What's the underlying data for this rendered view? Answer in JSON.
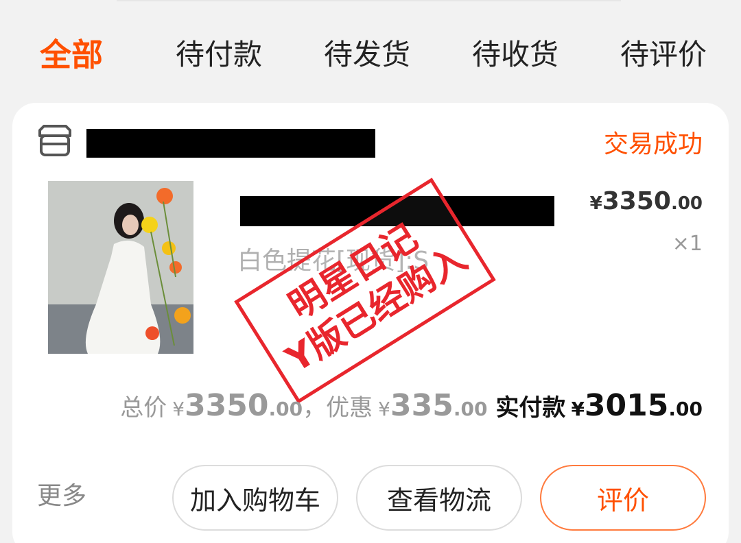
{
  "tabs": [
    "全部",
    "待付款",
    "待发货",
    "待收货",
    "待评价"
  ],
  "order": {
    "status": "交易成功",
    "sku": "白色提花[现货]:S",
    "unit_price": {
      "currency": "¥",
      "int": "3350",
      "dec": ".00"
    },
    "quantity": "×1",
    "stamp": {
      "line1": "明星日记",
      "line2": "Y版已经购入"
    },
    "totals": {
      "total_label": "总价",
      "total_int": "3350",
      "total_dec": ".00",
      "discount_label": "，优惠",
      "discount_int": "335",
      "discount_dec": ".00",
      "paid_label": "实付款",
      "paid_int": "3015",
      "paid_dec": ".00",
      "currency": "¥"
    }
  },
  "actions": {
    "more": "更多",
    "add_to_cart": "加入购物车",
    "view_logistics": "查看物流",
    "review": "评价"
  },
  "colors": {
    "accent": "#ff5000",
    "stamp": "#e8262d"
  }
}
